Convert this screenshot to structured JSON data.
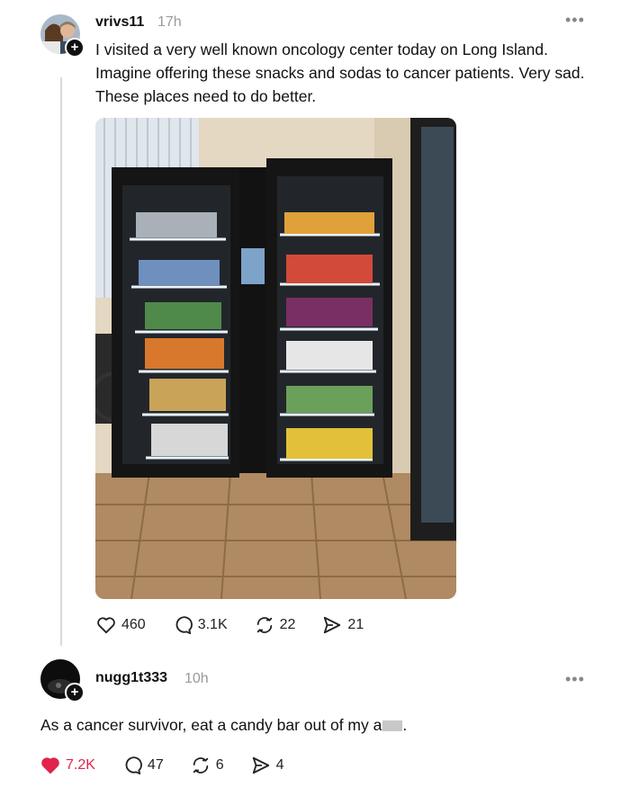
{
  "post": {
    "username": "vrivs11",
    "time": "17h",
    "text": "I visited a very well known oncology center today on Long Island. Imagine offering these snacks and sodas to cancer patients. Very sad. These places need to do better.",
    "stats": {
      "likes": "460",
      "comments": "3.1K",
      "reposts": "22",
      "shares": "21"
    }
  },
  "reply": {
    "username": "nugg1t333",
    "time": "10h",
    "text": "As a cancer survivor, eat a candy bar out of my a",
    "text_end": ".",
    "stats": {
      "likes": "7.2K",
      "comments": "47",
      "reposts": "6",
      "shares": "4"
    }
  },
  "icons": {
    "more": "ellipsis-icon",
    "like": "heart-icon",
    "comment": "speech-bubble-icon",
    "repost": "repost-icon",
    "share": "send-icon",
    "follow": "plus-icon"
  },
  "colors": {
    "liked_heart": "#e0244b",
    "muted_text": "#9a9a9a"
  }
}
